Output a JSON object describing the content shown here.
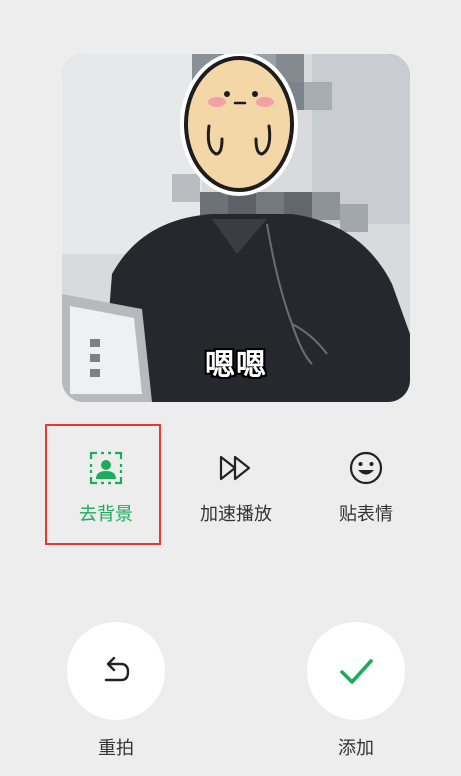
{
  "preview": {
    "caption": "嗯嗯"
  },
  "tools": [
    {
      "label": "去背景",
      "icon": "portrait-cutout-icon",
      "active": true
    },
    {
      "label": "加速播放",
      "icon": "fast-forward-icon",
      "active": false
    },
    {
      "label": "贴表情",
      "icon": "smiley-icon",
      "active": false
    }
  ],
  "actions": {
    "retake_label": "重拍",
    "retake_icon": "undo-arrow-icon",
    "add_label": "添加",
    "add_icon": "checkmark-icon"
  },
  "colors": {
    "accent": "#1aad5a",
    "highlight_border": "#e53935",
    "background": "#ededed"
  }
}
